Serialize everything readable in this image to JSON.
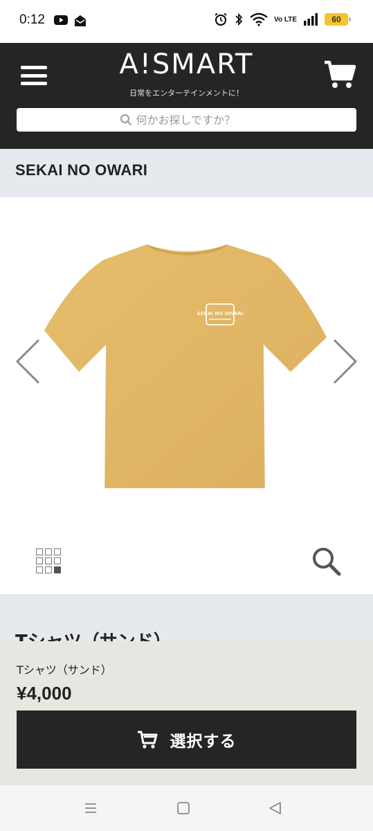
{
  "status_bar": {
    "time": "0:12",
    "battery": "60",
    "network_label": "Vo LTE"
  },
  "header": {
    "logo": "A!SMART",
    "tagline": "日常をエンターテインメントに！",
    "search_placeholder": "何かお探しですか？"
  },
  "brand": {
    "name": "SEKAI NO OWARI"
  },
  "product": {
    "title": "Tシャツ（サンド）",
    "name": "Tシャツ（サンド）",
    "price": "¥4,000",
    "print_text": "SEKAI NO OWARI",
    "shirt_color": "#e3b866"
  },
  "actions": {
    "select_label": "選択する"
  },
  "colors": {
    "header_bg": "#252525",
    "brand_bar_bg": "#e6eaee",
    "panel_bg": "#e7e6e1",
    "battery": "#f4c430"
  }
}
